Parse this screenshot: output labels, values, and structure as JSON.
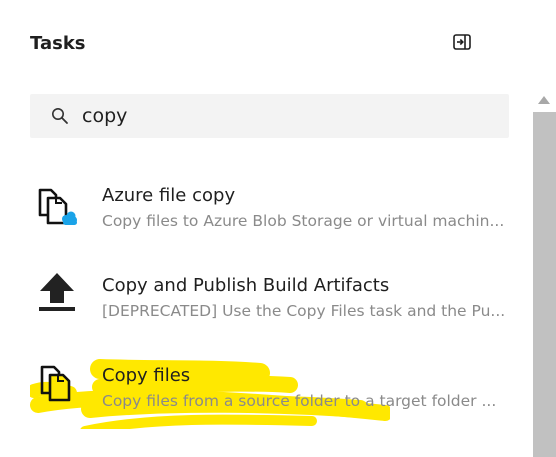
{
  "header": {
    "title": "Tasks",
    "collapse_icon": "panel-collapse-icon"
  },
  "search": {
    "value": "copy",
    "icon": "search-icon"
  },
  "tasks": [
    {
      "name": "Azure file copy",
      "description": "Copy files to Azure Blob Storage or virtual machin...",
      "icon": "azure-file-copy-icon"
    },
    {
      "name": "Copy and Publish Build Artifacts",
      "description": "[DEPRECATED] Use the Copy Files task and the Pu...",
      "icon": "upload-arrow-icon"
    },
    {
      "name": "Copy files",
      "description": "Copy files from a source folder to a target folder ...",
      "icon": "copy-files-icon",
      "highlighted": true
    }
  ],
  "colors": {
    "highlight": "#ffe800",
    "azure_cloud": "#1aa3e8",
    "description_text": "#8a8a8a",
    "search_background": "#f3f3f3",
    "scroll_thumb": "#c1c1c1"
  }
}
